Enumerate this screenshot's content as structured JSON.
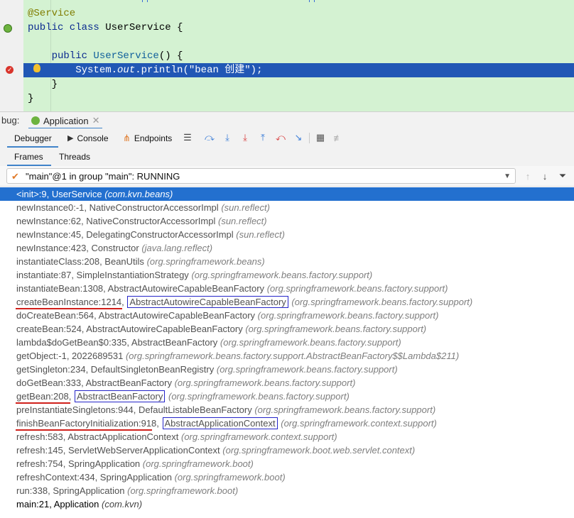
{
  "editor": {
    "lines": [
      {
        "parts": [
          {
            "t": "@Service",
            "c": "ann"
          }
        ]
      },
      {
        "parts": [
          {
            "t": "public class ",
            "c": "kw"
          },
          {
            "t": "UserService {",
            "c": ""
          }
        ]
      },
      {
        "parts": [
          {
            "t": "",
            "c": ""
          }
        ]
      },
      {
        "parts": [
          {
            "t": "    public ",
            "c": "kw"
          },
          {
            "t": "UserService",
            "c": "fn"
          },
          {
            "t": "() {",
            "c": ""
          }
        ]
      },
      {
        "parts": [
          {
            "t": "        System.",
            "c": ""
          },
          {
            "t": "out",
            "c": "it"
          },
          {
            "t": ".println(\"bean 创建\");",
            "c": ""
          }
        ]
      },
      {
        "parts": [
          {
            "t": "    }",
            "c": ""
          }
        ]
      },
      {
        "parts": [
          {
            "t": "}",
            "c": ""
          }
        ]
      }
    ]
  },
  "debug": {
    "label": "bug:",
    "tab_label": "Application",
    "toolbar": {
      "debugger": "Debugger",
      "console": "Console",
      "endpoints": "Endpoints"
    },
    "subtabs": {
      "frames": "Frames",
      "threads": "Threads"
    },
    "thread": "\"main\"@1 in group \"main\": RUNNING"
  },
  "frames": [
    {
      "name": "<init>:9, UserService",
      "pkg": "(com.kvn.beans)"
    },
    {
      "name": "newInstance0:-1, NativeConstructorAccessorImpl",
      "pkg": "(sun.reflect)"
    },
    {
      "name": "newInstance:62, NativeConstructorAccessorImpl",
      "pkg": "(sun.reflect)"
    },
    {
      "name": "newInstance:45, DelegatingConstructorAccessorImpl",
      "pkg": "(sun.reflect)"
    },
    {
      "name": "newInstance:423, Constructor",
      "pkg": "(java.lang.reflect)"
    },
    {
      "name": "instantiateClass:208, BeanUtils",
      "pkg": "(org.springframework.beans)"
    },
    {
      "name": "instantiate:87, SimpleInstantiationStrategy",
      "pkg": "(org.springframework.beans.factory.support)"
    },
    {
      "name": "instantiateBean:1308, AbstractAutowireCapableBeanFactory",
      "pkg": "(org.springframework.beans.factory.support)"
    },
    {
      "name": "createBeanInstance:1214",
      "box": "AbstractAutowireCapableBeanFactory",
      "pkg": "(org.springframework.beans.factory.support)"
    },
    {
      "name": "doCreateBean:564, AbstractAutowireCapableBeanFactory",
      "pkg": "(org.springframework.beans.factory.support)"
    },
    {
      "name": "createBean:524, AbstractAutowireCapableBeanFactory",
      "pkg": "(org.springframework.beans.factory.support)"
    },
    {
      "name": "lambda$doGetBean$0:335, AbstractBeanFactory",
      "pkg": "(org.springframework.beans.factory.support)"
    },
    {
      "name": "getObject:-1, 2022689531",
      "pkg": "(org.springframework.beans.factory.support.AbstractBeanFactory$$Lambda$211)"
    },
    {
      "name": "getSingleton:234, DefaultSingletonBeanRegistry",
      "pkg": "(org.springframework.beans.factory.support)"
    },
    {
      "name": "doGetBean:333, AbstractBeanFactory",
      "pkg": "(org.springframework.beans.factory.support)"
    },
    {
      "name": "getBean:208",
      "box": "AbstractBeanFactory",
      "pkg": "(org.springframework.beans.factory.support)"
    },
    {
      "name": "preInstantiateSingletons:944, DefaultListableBeanFactory",
      "pkg": "(org.springframework.beans.factory.support)"
    },
    {
      "name": "finishBeanFactoryInitialization:918",
      "box": "AbstractApplicationContext",
      "pkg": "(org.springframework.context.support)"
    },
    {
      "name": "refresh:583, AbstractApplicationContext",
      "pkg": "(org.springframework.context.support)"
    },
    {
      "name": "refresh:145, ServletWebServerApplicationContext",
      "pkg": "(org.springframework.boot.web.servlet.context)"
    },
    {
      "name": "refresh:754, SpringApplication",
      "pkg": "(org.springframework.boot)"
    },
    {
      "name": "refreshContext:434, SpringApplication",
      "pkg": "(org.springframework.boot)"
    },
    {
      "name": "run:338, SpringApplication",
      "pkg": "(org.springframework.boot)"
    },
    {
      "name": "main:21, Application",
      "pkg": "(com.kvn)"
    }
  ],
  "colors": {
    "selection": "#2370cf",
    "editor_bg": "#d4f2d2",
    "highlight_line": "#2157b5",
    "annotation_box": "#2424c8",
    "underline": "#d0201b"
  }
}
